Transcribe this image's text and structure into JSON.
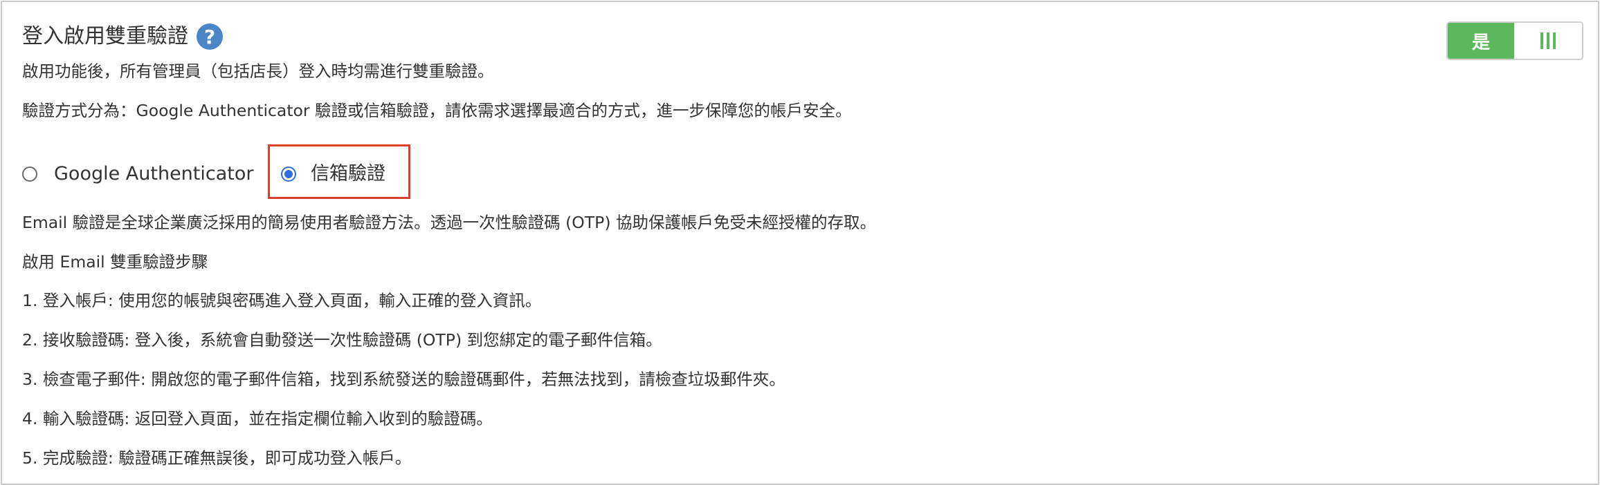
{
  "header": {
    "title": "登入啟用雙重驗證",
    "help_icon": "question-circle-icon"
  },
  "toggle": {
    "state": "on",
    "on_label": "是",
    "handle_icon": "grip-lines-icon",
    "accent_color": "#5cb85c"
  },
  "description": {
    "line1": "啟用功能後，所有管理員（包括店長）登入時均需進行雙重驗證。",
    "line2": "驗證方式分為：Google Authenticator 驗證或信箱驗證，請依需求選擇最適合的方式，進一步保障您的帳戶安全。"
  },
  "method": {
    "selected": "email",
    "options": [
      {
        "id": "google",
        "label": "Google Authenticator",
        "checked": false
      },
      {
        "id": "email",
        "label": "信箱驗證",
        "checked": true
      }
    ],
    "highlight_color": "#d9402c"
  },
  "email_info": {
    "description": "Email 驗證是全球企業廣泛採用的簡易使用者驗證方法。透過一次性驗證碼 (OTP) 協助保護帳戶免受未經授權的存取。",
    "steps_title": "啟用 Email 雙重驗證步驟",
    "steps": [
      "1. 登入帳戶: 使用您的帳號與密碼進入登入頁面，輸入正確的登入資訊。",
      "2. 接收驗證碼: 登入後，系統會自動發送一次性驗證碼 (OTP) 到您綁定的電子郵件信箱。",
      "3. 檢查電子郵件: 開啟您的電子郵件信箱，找到系統發送的驗證碼郵件，若無法找到，請檢查垃圾郵件夾。",
      "4. 輸入驗證碼: 返回登入頁面，並在指定欄位輸入收到的驗證碼。",
      "5. 完成驗證: 驗證碼正確無誤後，即可成功登入帳戶。"
    ]
  }
}
